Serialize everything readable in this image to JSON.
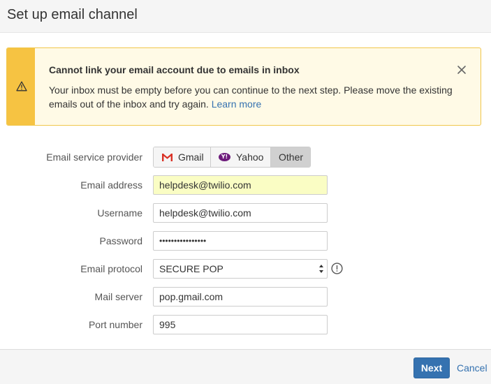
{
  "dialog": {
    "title": "Set up email channel"
  },
  "alert": {
    "icon": "warning-icon",
    "title": "Cannot link your email account due to emails in inbox",
    "message": "Your inbox must be empty before you can continue to the next step. Please move the existing emails out of the inbox and try again.",
    "link_label": "Learn more",
    "close_icon": "close-icon",
    "colors": {
      "side": "#f6c342",
      "background": "#fffae6",
      "border": "#f0c64b"
    }
  },
  "form": {
    "provider": {
      "label": "Email service provider",
      "options": [
        {
          "label": "Gmail",
          "icon": "gmail-icon"
        },
        {
          "label": "Yahoo",
          "icon": "yahoo-icon"
        },
        {
          "label": "Other",
          "icon": ""
        }
      ],
      "selected": "Other"
    },
    "email_address": {
      "label": "Email address",
      "value": "helpdesk@twilio.com"
    },
    "username": {
      "label": "Username",
      "value": "helpdesk@twilio.com"
    },
    "password": {
      "label": "Password",
      "value": "••••••••••••••••"
    },
    "protocol": {
      "label": "Email protocol",
      "value": "SECURE POP",
      "info_icon": "info-icon"
    },
    "mail_server": {
      "label": "Mail server",
      "value": "pop.gmail.com"
    },
    "port": {
      "label": "Port number",
      "value": "995"
    }
  },
  "footer": {
    "next_label": "Next",
    "cancel_label": "Cancel",
    "colors": {
      "primary": "#3572b0"
    }
  }
}
